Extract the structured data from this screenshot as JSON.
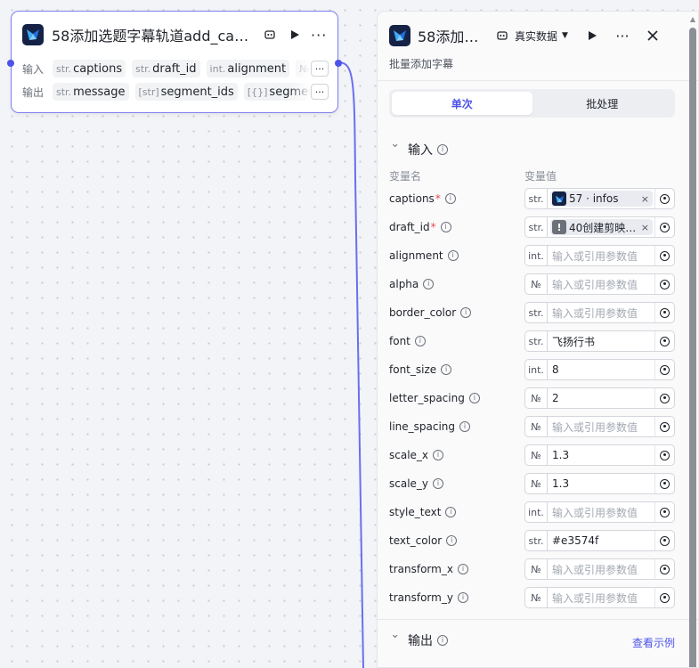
{
  "node": {
    "title": "58添加选题字幕轨道add_cap…",
    "input_label": "输入",
    "output_label": "输出",
    "inputs": [
      {
        "type": "str.",
        "name": "captions"
      },
      {
        "type": "str.",
        "name": "draft_id"
      },
      {
        "type": "int.",
        "name": "alignment"
      },
      {
        "type": "№",
        "name": "alpha"
      }
    ],
    "outputs": [
      {
        "type": "str.",
        "name": "message"
      },
      {
        "type": "[str]",
        "name": "segment_ids"
      },
      {
        "type": "[{}]",
        "name": "segments"
      }
    ],
    "more": "···"
  },
  "panel": {
    "title": "58添加…",
    "data_mode": "真实数据",
    "subtitle": "批量添加字幕",
    "tabs": [
      "单次",
      "批处理"
    ],
    "active_tab": 0,
    "input_section": "输入",
    "col_name": "变量名",
    "col_value": "变量值",
    "params": [
      {
        "name": "captions",
        "required": true,
        "type": "str.",
        "ref": {
          "kind": "app",
          "text": "57 · infos"
        }
      },
      {
        "name": "draft_id",
        "required": true,
        "type": "str.",
        "ref": {
          "kind": "warn",
          "text": "40创建剪映…  ·"
        }
      },
      {
        "name": "alignment",
        "required": false,
        "type": "int.",
        "value": "",
        "placeholder": "输入或引用参数值"
      },
      {
        "name": "alpha",
        "required": false,
        "type": "№",
        "value": "",
        "placeholder": "输入或引用参数值"
      },
      {
        "name": "border_color",
        "required": false,
        "type": "str.",
        "value": "",
        "placeholder": "输入或引用参数值"
      },
      {
        "name": "font",
        "required": false,
        "type": "str.",
        "value": "飞扬行书",
        "placeholder": ""
      },
      {
        "name": "font_size",
        "required": false,
        "type": "int.",
        "value": "8",
        "placeholder": ""
      },
      {
        "name": "letter_spacing",
        "required": false,
        "type": "№",
        "value": "2",
        "placeholder": ""
      },
      {
        "name": "line_spacing",
        "required": false,
        "type": "№",
        "value": "",
        "placeholder": "输入或引用参数值"
      },
      {
        "name": "scale_x",
        "required": false,
        "type": "№",
        "value": "1.3",
        "placeholder": ""
      },
      {
        "name": "scale_y",
        "required": false,
        "type": "№",
        "value": "1.3",
        "placeholder": ""
      },
      {
        "name": "style_text",
        "required": false,
        "type": "int.",
        "value": "",
        "placeholder": "输入或引用参数值"
      },
      {
        "name": "text_color",
        "required": false,
        "type": "str.",
        "value": "#e3574f",
        "placeholder": ""
      },
      {
        "name": "transform_x",
        "required": false,
        "type": "№",
        "value": "",
        "placeholder": "输入或引用参数值"
      },
      {
        "name": "transform_y",
        "required": false,
        "type": "№",
        "value": "",
        "placeholder": "输入或引用参数值"
      }
    ],
    "output_section": "输出",
    "view_example": "查看示例"
  },
  "colors": {
    "accent": "#4d53e8",
    "edge": "#6a6ff0",
    "required": "#e5484d"
  }
}
